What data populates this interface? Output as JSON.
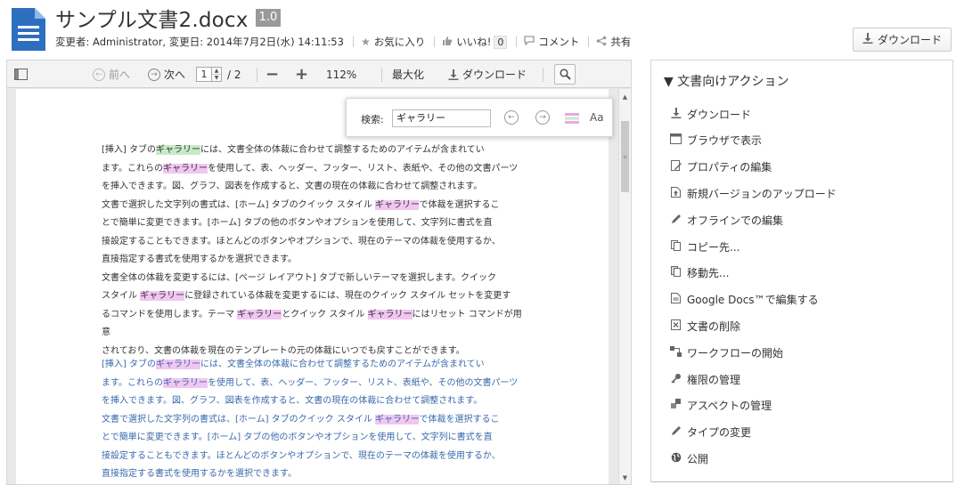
{
  "document": {
    "title": "サンプル文書2.docx",
    "version": "1.0",
    "modified_info": "変更者: Administrator, 変更日: 2014年7月2日(水) 14:11:53",
    "favorite_label": "お気に入り",
    "like_label": "いいね!",
    "like_count": "0",
    "comment_label": "コメント",
    "share_label": "共有",
    "download_button_label": "ダウンロード"
  },
  "viewer": {
    "toolbar": {
      "prev_label": "前へ",
      "next_label": "次へ",
      "page_value": "1",
      "page_total": "/ 2",
      "zoom_value": "112%",
      "maximize_label": "最大化",
      "download_label": "ダウンロード"
    },
    "find": {
      "label": "検索:",
      "value": "ギャラリー",
      "case_label": "Aa"
    },
    "content": {
      "block1": [
        [
          "[挿入] タブの",
          "ギャラリー",
          "には、文書全体の体裁に合わせて調整するためのアイテムが含まれてい"
        ],
        [
          "ます。これらの",
          "ギャラリー",
          "を使用して、表、ヘッダー、フッター、リスト、表紙や、その他の文書パーツ"
        ],
        [
          "を挿入できます。図、グラフ、図表を作成すると、文書の現在の体裁に合わせて調整されます。"
        ],
        [
          "文書で選択した文字列の書式は、[ホーム] タブのクイック スタイル ",
          "ギャラリー",
          "で体裁を選択するこ"
        ],
        [
          "とで簡単に変更できます。[ホーム] タブの他のボタンやオプションを使用して、文字列に書式を直"
        ],
        [
          "接設定することもできます。ほとんどのボタンやオプションで、現在のテーマの体裁を使用するか、"
        ],
        [
          "直接指定する書式を使用するかを選択できます。"
        ],
        [
          "文書全体の体裁を変更するには、[ページ レイアウト] タブで新しいテーマを選択します。クイック"
        ],
        [
          "スタイル ",
          "ギャラリー",
          "に登録されている体裁を変更するには、現在のクイック スタイル セットを変更す"
        ],
        [
          "るコマンドを使用します。テーマ ",
          "ギャラリー",
          "とクイック スタイル ",
          "ギャラリー",
          "にはリセット コマンドが用意"
        ],
        [
          "されており、文書の体裁を現在のテンプレートの元の体裁にいつでも戻すことができます。"
        ]
      ],
      "block2": [
        [
          "[挿入] タブの",
          "ギャラリー",
          "には、文書全体の体裁に合わせて調整するためのアイテムが含まれてい"
        ],
        [
          "ます。これらの",
          "ギャラリー",
          "を使用して、表、ヘッダー、フッター、リスト、表紙や、その他の文書パーツ"
        ],
        [
          "を挿入できます。図、グラフ、図表を作成すると、文書の現在の体裁に合わせて調整されます。"
        ],
        [
          "文書で選択した文字列の書式は、[ホーム] タブのクイック スタイル ",
          "ギャラリー",
          "で体裁を選択するこ"
        ],
        [
          "とで簡単に変更できます。[ホーム] タブの他のボタンやオプションを使用して、文字列に書式を直"
        ],
        [
          "接設定することもできます。ほとんどのボタンやオプションで、現在のテーマの体裁を使用するか、"
        ],
        [
          "直接指定する書式を使用するかを選択できます。"
        ]
      ]
    }
  },
  "side_panel": {
    "title": "▼ 文書向けアクション",
    "actions": [
      {
        "label": "ダウンロード",
        "icon": "download-icon"
      },
      {
        "label": "ブラウザで表示",
        "icon": "browser-icon"
      },
      {
        "label": "プロパティの編集",
        "icon": "edit-properties-icon"
      },
      {
        "label": "新規バージョンのアップロード",
        "icon": "upload-version-icon"
      },
      {
        "label": "オフラインでの編集",
        "icon": "pencil-icon"
      },
      {
        "label": "コピー先...",
        "icon": "copy-icon"
      },
      {
        "label": "移動先...",
        "icon": "move-icon"
      },
      {
        "label": "Google Docs™で編集する",
        "icon": "google-docs-icon"
      },
      {
        "label": "文書の削除",
        "icon": "delete-icon"
      },
      {
        "label": "ワークフローの開始",
        "icon": "workflow-icon"
      },
      {
        "label": "権限の管理",
        "icon": "key-icon"
      },
      {
        "label": "アスペクトの管理",
        "icon": "aspect-icon"
      },
      {
        "label": "タイプの変更",
        "icon": "pencil-icon"
      },
      {
        "label": "公開",
        "icon": "globe-icon"
      }
    ]
  },
  "colors": {
    "highlight_current": "#c7eac7",
    "highlight_match": "#f1c6f1",
    "blue_text": "#3a6aab",
    "doc_icon_blue": "#2d6fbf"
  }
}
